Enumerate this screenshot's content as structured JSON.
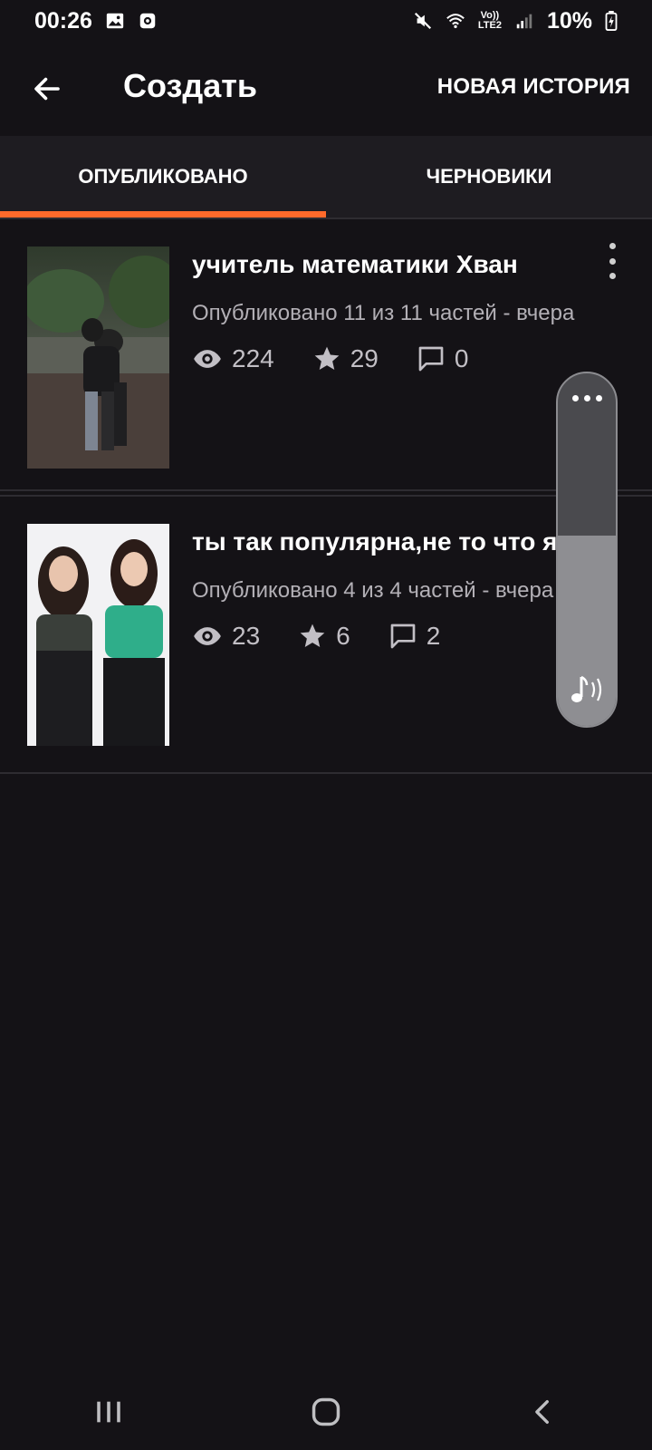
{
  "status_bar": {
    "time": "00:26",
    "network": "Vo))\nLTE2",
    "battery": "10%"
  },
  "app_bar": {
    "title": "Создать",
    "new_story_label": "НОВАЯ ИСТОРИЯ"
  },
  "tabs": [
    {
      "label": "ОПУБЛИКОВАНО",
      "active": true
    },
    {
      "label": "ЧЕРНОВИКИ",
      "active": false
    }
  ],
  "stories": [
    {
      "title": "учитель математики Хван",
      "subtitle": "Опубликовано 11 из 11 частей - вчера",
      "views": "224",
      "votes": "29",
      "comments": "0"
    },
    {
      "title": "ты так популярна,не то что я",
      "subtitle": "Опубликовано 4 из 4 частей - вчера",
      "views": "23",
      "votes": "6",
      "comments": "2"
    }
  ],
  "volume": {
    "level": 0.54
  },
  "colors": {
    "accent": "#ff6a2b",
    "background": "#141216"
  }
}
